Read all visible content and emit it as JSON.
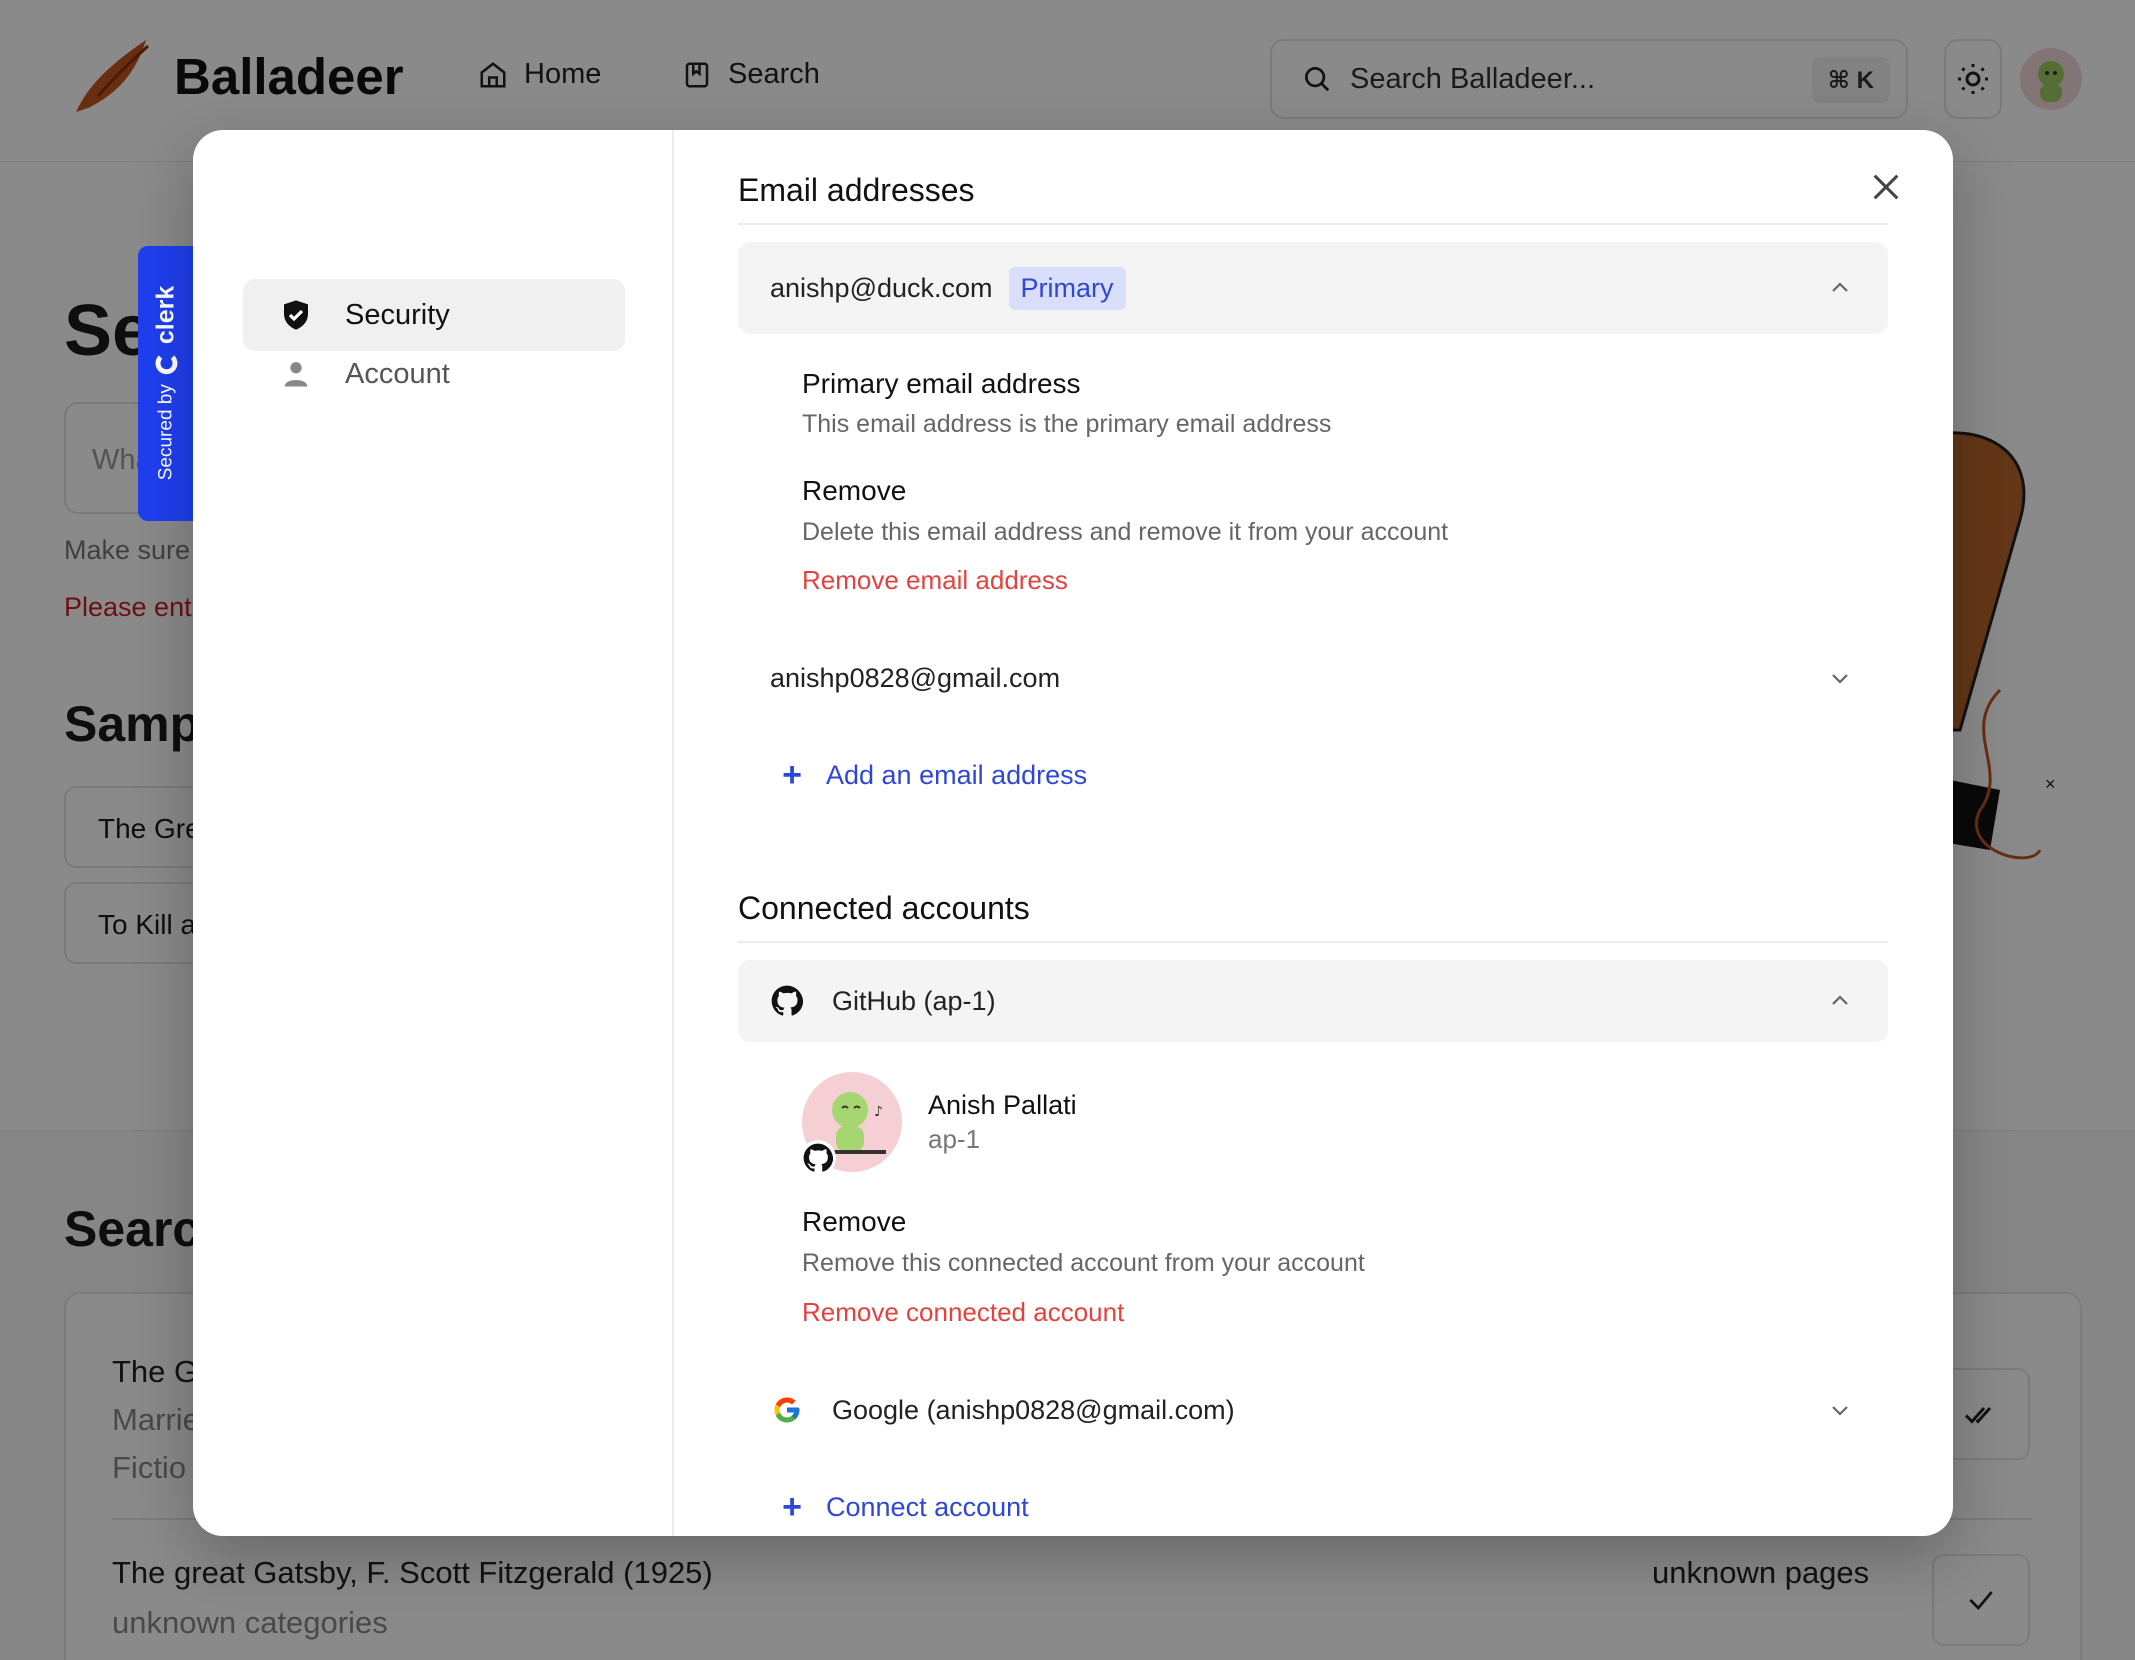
{
  "app": {
    "name": "Balladeer",
    "nav": [
      {
        "label": "Home"
      },
      {
        "label": "Search"
      }
    ],
    "search_placeholder": "Search Balladeer...",
    "search_shortcut": "⌘ K"
  },
  "background": {
    "heading": "Se",
    "input_placeholder": "Wha",
    "hint": "Make sure",
    "error": "Please ent",
    "samples_heading": "Samp",
    "samples": [
      "The Gre",
      "To Kill a"
    ],
    "results_heading": "Searc",
    "result1": {
      "title": "The G",
      "line2": "Marrie",
      "line3": "Fictio"
    },
    "result2": {
      "title": "The great Gatsby, F. Scott Fitzgerald (1925)",
      "categories": "unknown categories",
      "pages": "unknown pages"
    }
  },
  "clerk_badge": {
    "prefix": "Secured by",
    "brand": "clerk"
  },
  "modal": {
    "sidebar": [
      {
        "label": "Account",
        "icon": "user-icon"
      },
      {
        "label": "Security",
        "icon": "shield-check-icon",
        "active": true
      }
    ],
    "email_section": {
      "title": "Email addresses",
      "emails": [
        {
          "address": "anishp@duck.com",
          "badge": "Primary",
          "expanded": true,
          "primary_title": "Primary email address",
          "primary_desc": "This email address is the primary email address",
          "remove_title": "Remove",
          "remove_desc": "Delete this email address and remove it from your account",
          "remove_action": "Remove email address"
        },
        {
          "address": "anishp0828@gmail.com",
          "expanded": false
        }
      ],
      "add_label": "Add an email address"
    },
    "connected_section": {
      "title": "Connected accounts",
      "accounts": [
        {
          "provider": "GitHub (ap-1)",
          "icon": "github-icon",
          "expanded": true,
          "display_name": "Anish Pallati",
          "username": "ap-1",
          "remove_title": "Remove",
          "remove_desc": "Remove this connected account from your account",
          "remove_action": "Remove connected account"
        },
        {
          "provider": "Google (anishp0828@gmail.com)",
          "icon": "google-icon",
          "expanded": false
        }
      ],
      "connect_label": "Connect account"
    }
  },
  "colors": {
    "accent": "#2f47d8",
    "danger": "#e5423e",
    "clerk_blue": "#1f3ff0",
    "logo_orange": "#c2561d"
  }
}
